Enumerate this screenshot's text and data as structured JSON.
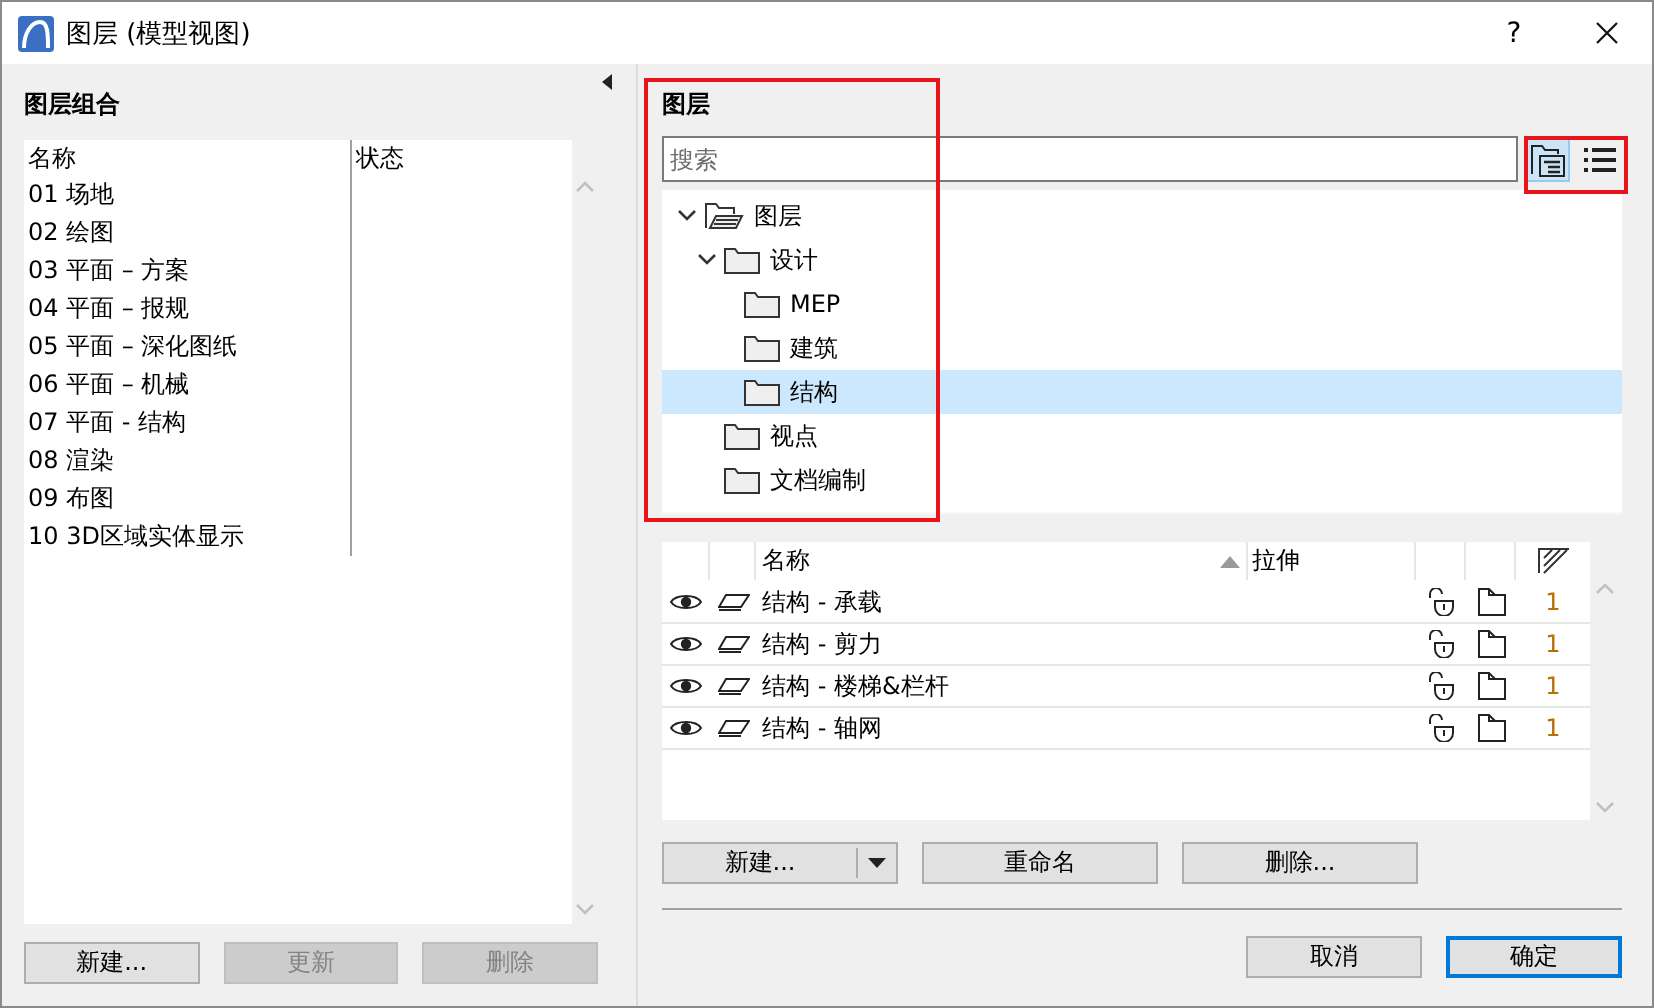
{
  "window": {
    "title": "图层 (模型视图)",
    "help": "?"
  },
  "layer_combinations": {
    "title": "图层组合",
    "columns": [
      "名称",
      "状态"
    ],
    "rows": [
      "01 场地",
      "02 绘图",
      "03 平面 – 方案",
      "04 平面 – 报规",
      "05 平面 – 深化图纸",
      "06 平面 – 机械",
      "07 平面 - 结构",
      "08 渲染",
      "09 布图",
      "10 3D区域实体显示"
    ],
    "buttons": [
      {
        "label": "新建...",
        "disabled": false
      },
      {
        "label": "更新",
        "disabled": true
      },
      {
        "label": "删除",
        "disabled": true
      }
    ]
  },
  "layers": {
    "title": "图层",
    "search": {
      "placeholder": "搜索"
    },
    "view_toggle": [
      {
        "kind": "tree",
        "selected": true
      },
      {
        "kind": "list",
        "selected": false
      }
    ],
    "tree": [
      {
        "label": "图层",
        "kind": "root",
        "expanded": true,
        "selected": false,
        "children": [
          {
            "label": "设计",
            "kind": "folder",
            "expanded": true,
            "selected": false,
            "children": [
              {
                "label": "MEP",
                "kind": "folder",
                "selected": false
              },
              {
                "label": "建筑",
                "kind": "folder",
                "selected": false
              },
              {
                "label": "结构",
                "kind": "folder",
                "selected": true
              }
            ]
          },
          {
            "label": "视点",
            "kind": "folder",
            "selected": false
          },
          {
            "label": "文档编制",
            "kind": "folder",
            "selected": false
          }
        ]
      }
    ],
    "table": {
      "columns": [
        "名称",
        "拉伸"
      ],
      "rows": [
        {
          "name": "结构 - 承载",
          "pen": "1"
        },
        {
          "name": "结构 - 剪力",
          "pen": "1"
        },
        {
          "name": "结构 - 楼梯&栏杆",
          "pen": "1"
        },
        {
          "name": "结构 - 轴网",
          "pen": "1"
        }
      ]
    },
    "buttons": [
      {
        "label": "新建...",
        "kind": "split"
      },
      {
        "label": "重命名",
        "kind": "plain"
      },
      {
        "label": "删除...",
        "kind": "plain"
      }
    ]
  },
  "dialog_buttons": [
    {
      "label": "取消",
      "default": false
    },
    {
      "label": "确定",
      "default": true
    }
  ]
}
